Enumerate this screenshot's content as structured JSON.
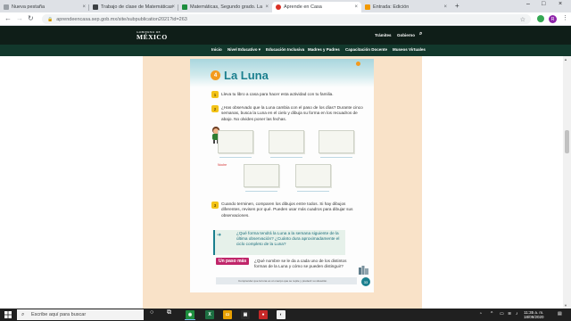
{
  "browser": {
    "tabs": [
      {
        "title": "Nueva pestaña",
        "active": false,
        "favicon_color": "#9aa0a6"
      },
      {
        "title": "Trabajo de clase de Matemáticas",
        "active": false,
        "favicon_color": "#3c4043"
      },
      {
        "title": "Matemáticas, Segundo grado. La",
        "active": false,
        "favicon_color": "#1e8e3e"
      },
      {
        "title": "Aprende en Casa",
        "active": true,
        "favicon_color": "#d93025"
      },
      {
        "title": "Entrada: Edición",
        "active": false,
        "favicon_color": "#f29900"
      }
    ],
    "new_tab": "+",
    "url": "aprendeencasa.sep.gob.mx/site/subpublication2021?id=263",
    "profile_initial": "R"
  },
  "site": {
    "logo_small": "GOBIERNO DE",
    "logo_big": "MÉXICO",
    "top_links": [
      "Trámites",
      "Gobierno"
    ],
    "nav": [
      "Inicio",
      "Nivel Educativo ▾",
      "Educación Inclusiva",
      "Madres y Padres",
      "Capacitación Docente",
      "Museos Virtuales"
    ]
  },
  "page": {
    "lesson_number": "4",
    "lesson_title": "La Luna",
    "step1_text": "Lleva tu libro a casa para hacer esta actividad con tu familia.",
    "step2_text": "¿Has observado que la Luna cambia con el paso de los días? Durante cinco semanas, busca la Luna en el cielo y dibuja su forma en los recuadros de abajo. No olvides poner las fechas.",
    "noche_label": "Noche",
    "step3_text": "Cuando terminen, comparen los dibujos entre todos. Si hay dibujos diferentes, revisen por qué. Pueden usar más cuadros para dibujar sus observaciones.",
    "question_text": "¿Qué forma tendrá la Luna a la semana siguiente de la última observación? ¿Cuánto dura aproximadamente el ciclo completo de la Luna?",
    "unpoco_label": "Un paso más",
    "unpoco_question": "¿Qué nombre se le da a cada uno de los distintos formas de la Luna y cómo se pueden distinguir?",
    "bottom_caption": "Comprender que la luna es un cuerpo que se repite y predecir su situación.",
    "page_number": "33",
    "accent_color": "#1a7f8e"
  },
  "taskbar": {
    "search_placeholder": "Escribe aquí para buscar",
    "time": "11:35 a. m.",
    "date": "18/09/2020"
  }
}
